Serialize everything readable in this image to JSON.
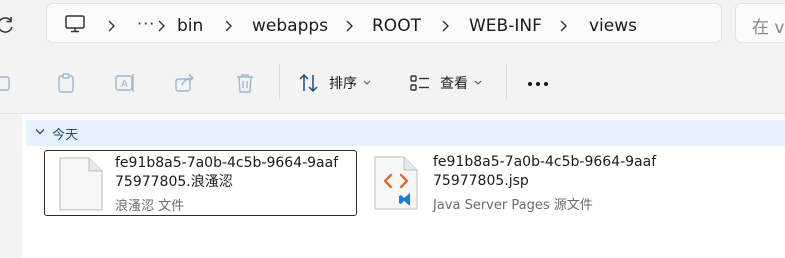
{
  "address_bar": {
    "breadcrumbs": [
      {
        "label": "bin"
      },
      {
        "label": "webapps"
      },
      {
        "label": "ROOT"
      },
      {
        "label": "WEB-INF"
      },
      {
        "label": "views"
      }
    ],
    "overflow": "···"
  },
  "search": {
    "placeholder": "在 views 中搜索",
    "visible": "在 v"
  },
  "toolbar": {
    "sort_label": "排序",
    "view_label": "查看",
    "more_label": "•••"
  },
  "group": {
    "label": "今天"
  },
  "files": [
    {
      "name": "fe91b8a5-7a0b-4c5b-9664-9aaf\n75977805.浪溞涊",
      "type": "浪溞涊 文件",
      "icon": "blank-file-icon",
      "selected": true
    },
    {
      "name": "fe91b8a5-7a0b-4c5b-9664-9aaf\n75977805.jsp",
      "type": "Java Server Pages 源文件",
      "icon": "jsp-file-icon",
      "selected": false
    }
  ],
  "colors": {
    "accent": "#0a66c2",
    "group_bg": "#e6f1fb",
    "jsp_orange": "#e06b2b"
  }
}
